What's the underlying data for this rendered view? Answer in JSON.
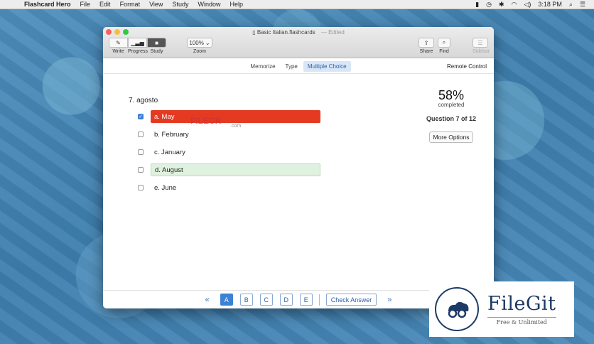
{
  "menubar": {
    "app_name": "Flashcard Hero",
    "items": [
      "File",
      "Edit",
      "Format",
      "View",
      "Study",
      "Window",
      "Help"
    ],
    "clock": "3:18 PM"
  },
  "window": {
    "title": "Basic Italian.flashcards",
    "edited": "Edited",
    "toolbar": {
      "write": "Write",
      "progress": "Progress",
      "study": "Study",
      "zoom_value": "100%",
      "zoom_label": "Zoom",
      "share": "Share",
      "find": "Find",
      "sidebar": "Sidebar"
    },
    "modes": [
      "Memorize",
      "Type",
      "Multiple Choice"
    ],
    "active_mode": "Multiple Choice",
    "remote_control": "Remote Control"
  },
  "quiz": {
    "question": "7. agosto",
    "options": [
      {
        "label": "a. May",
        "checked": true,
        "state": "wrong"
      },
      {
        "label": "b. February",
        "checked": false,
        "state": "none"
      },
      {
        "label": "c. January",
        "checked": false,
        "state": "none"
      },
      {
        "label": "d. August",
        "checked": false,
        "state": "correct"
      },
      {
        "label": "e. June",
        "checked": false,
        "state": "none"
      }
    ],
    "percent": "58%",
    "completed_label": "completed",
    "question_count": "Question 7 of 12",
    "more_options": "More Options"
  },
  "bottom_nav": {
    "prev": "«",
    "next": "»",
    "letters": [
      "A",
      "B",
      "C",
      "D",
      "E"
    ],
    "active_letter": "A",
    "check_answer": "Check Answer"
  },
  "watermarks": {
    "center": "FILECR",
    "center_sub": ".com",
    "brand": "FileGit",
    "brand_tag": "Free & Unlimited"
  },
  "colors": {
    "wrong": "#e43a22",
    "correct": "#dff2df",
    "accent": "#3b82d6"
  }
}
